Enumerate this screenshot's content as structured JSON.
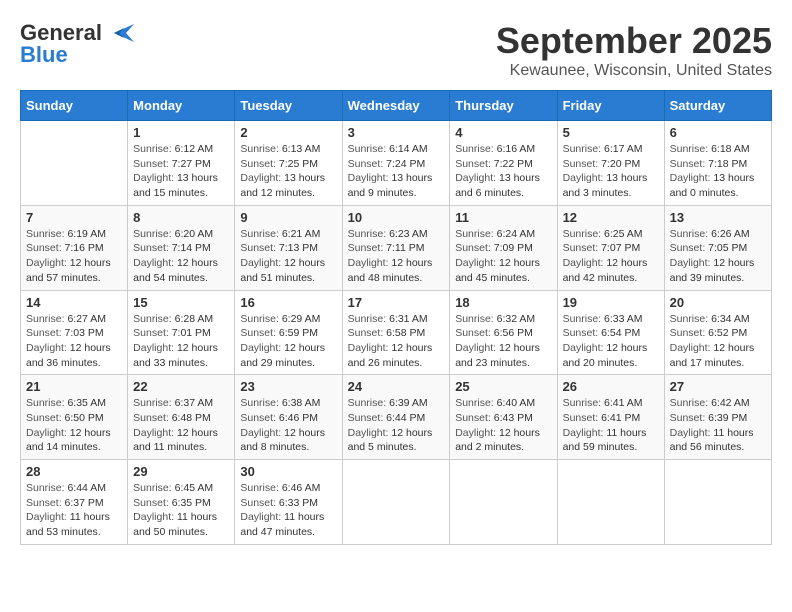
{
  "logo": {
    "line1": "General",
    "line2": "Blue",
    "icon": "▶"
  },
  "title": "September 2025",
  "subtitle": "Kewaunee, Wisconsin, United States",
  "days_header": [
    "Sunday",
    "Monday",
    "Tuesday",
    "Wednesday",
    "Thursday",
    "Friday",
    "Saturday"
  ],
  "weeks": [
    [
      {
        "day": "",
        "sunrise": "",
        "sunset": "",
        "daylight": ""
      },
      {
        "day": "1",
        "sunrise": "6:12 AM",
        "sunset": "7:27 PM",
        "daylight": "13 hours and 15 minutes."
      },
      {
        "day": "2",
        "sunrise": "6:13 AM",
        "sunset": "7:25 PM",
        "daylight": "13 hours and 12 minutes."
      },
      {
        "day": "3",
        "sunrise": "6:14 AM",
        "sunset": "7:24 PM",
        "daylight": "13 hours and 9 minutes."
      },
      {
        "day": "4",
        "sunrise": "6:16 AM",
        "sunset": "7:22 PM",
        "daylight": "13 hours and 6 minutes."
      },
      {
        "day": "5",
        "sunrise": "6:17 AM",
        "sunset": "7:20 PM",
        "daylight": "13 hours and 3 minutes."
      },
      {
        "day": "6",
        "sunrise": "6:18 AM",
        "sunset": "7:18 PM",
        "daylight": "13 hours and 0 minutes."
      }
    ],
    [
      {
        "day": "7",
        "sunrise": "6:19 AM",
        "sunset": "7:16 PM",
        "daylight": "12 hours and 57 minutes."
      },
      {
        "day": "8",
        "sunrise": "6:20 AM",
        "sunset": "7:14 PM",
        "daylight": "12 hours and 54 minutes."
      },
      {
        "day": "9",
        "sunrise": "6:21 AM",
        "sunset": "7:13 PM",
        "daylight": "12 hours and 51 minutes."
      },
      {
        "day": "10",
        "sunrise": "6:23 AM",
        "sunset": "7:11 PM",
        "daylight": "12 hours and 48 minutes."
      },
      {
        "day": "11",
        "sunrise": "6:24 AM",
        "sunset": "7:09 PM",
        "daylight": "12 hours and 45 minutes."
      },
      {
        "day": "12",
        "sunrise": "6:25 AM",
        "sunset": "7:07 PM",
        "daylight": "12 hours and 42 minutes."
      },
      {
        "day": "13",
        "sunrise": "6:26 AM",
        "sunset": "7:05 PM",
        "daylight": "12 hours and 39 minutes."
      }
    ],
    [
      {
        "day": "14",
        "sunrise": "6:27 AM",
        "sunset": "7:03 PM",
        "daylight": "12 hours and 36 minutes."
      },
      {
        "day": "15",
        "sunrise": "6:28 AM",
        "sunset": "7:01 PM",
        "daylight": "12 hours and 33 minutes."
      },
      {
        "day": "16",
        "sunrise": "6:29 AM",
        "sunset": "6:59 PM",
        "daylight": "12 hours and 29 minutes."
      },
      {
        "day": "17",
        "sunrise": "6:31 AM",
        "sunset": "6:58 PM",
        "daylight": "12 hours and 26 minutes."
      },
      {
        "day": "18",
        "sunrise": "6:32 AM",
        "sunset": "6:56 PM",
        "daylight": "12 hours and 23 minutes."
      },
      {
        "day": "19",
        "sunrise": "6:33 AM",
        "sunset": "6:54 PM",
        "daylight": "12 hours and 20 minutes."
      },
      {
        "day": "20",
        "sunrise": "6:34 AM",
        "sunset": "6:52 PM",
        "daylight": "12 hours and 17 minutes."
      }
    ],
    [
      {
        "day": "21",
        "sunrise": "6:35 AM",
        "sunset": "6:50 PM",
        "daylight": "12 hours and 14 minutes."
      },
      {
        "day": "22",
        "sunrise": "6:37 AM",
        "sunset": "6:48 PM",
        "daylight": "12 hours and 11 minutes."
      },
      {
        "day": "23",
        "sunrise": "6:38 AM",
        "sunset": "6:46 PM",
        "daylight": "12 hours and 8 minutes."
      },
      {
        "day": "24",
        "sunrise": "6:39 AM",
        "sunset": "6:44 PM",
        "daylight": "12 hours and 5 minutes."
      },
      {
        "day": "25",
        "sunrise": "6:40 AM",
        "sunset": "6:43 PM",
        "daylight": "12 hours and 2 minutes."
      },
      {
        "day": "26",
        "sunrise": "6:41 AM",
        "sunset": "6:41 PM",
        "daylight": "11 hours and 59 minutes."
      },
      {
        "day": "27",
        "sunrise": "6:42 AM",
        "sunset": "6:39 PM",
        "daylight": "11 hours and 56 minutes."
      }
    ],
    [
      {
        "day": "28",
        "sunrise": "6:44 AM",
        "sunset": "6:37 PM",
        "daylight": "11 hours and 53 minutes."
      },
      {
        "day": "29",
        "sunrise": "6:45 AM",
        "sunset": "6:35 PM",
        "daylight": "11 hours and 50 minutes."
      },
      {
        "day": "30",
        "sunrise": "6:46 AM",
        "sunset": "6:33 PM",
        "daylight": "11 hours and 47 minutes."
      },
      {
        "day": "",
        "sunrise": "",
        "sunset": "",
        "daylight": ""
      },
      {
        "day": "",
        "sunrise": "",
        "sunset": "",
        "daylight": ""
      },
      {
        "day": "",
        "sunrise": "",
        "sunset": "",
        "daylight": ""
      },
      {
        "day": "",
        "sunrise": "",
        "sunset": "",
        "daylight": ""
      }
    ]
  ],
  "labels": {
    "sunrise": "Sunrise: ",
    "sunset": "Sunset: ",
    "daylight": "Daylight: "
  }
}
